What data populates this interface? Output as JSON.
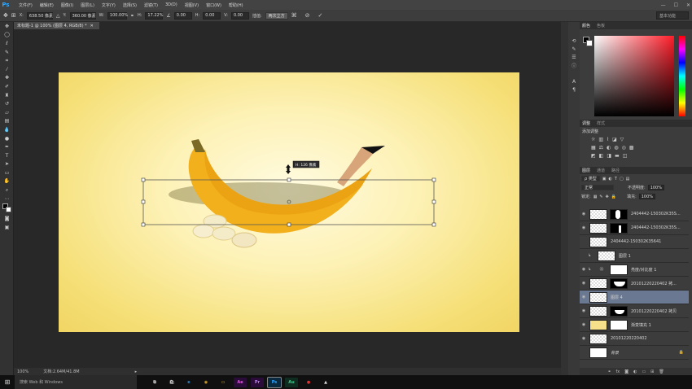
{
  "app": {
    "logo": "Ps"
  },
  "menu": [
    "文件(F)",
    "编辑(E)",
    "图像(I)",
    "图层(L)",
    "文字(Y)",
    "选择(S)",
    "滤镜(T)",
    "3D(D)",
    "视图(V)",
    "窗口(W)",
    "帮助(H)"
  ],
  "window_controls": {
    "minimize": "—",
    "maximize": "☐",
    "close": "✕"
  },
  "options": {
    "x_label": "X:",
    "x_value": "638.50 像素",
    "y_label": "Y:",
    "y_value": "360.00 像素",
    "w_label": "W:",
    "w_value": "100.00%",
    "h_label": "H:",
    "h_value": "17.22%",
    "angle_value": "0.00",
    "hskew_label": "H:",
    "hskew_value": "0.00",
    "vskew_label": "V:",
    "vskew_value": "0.00",
    "interp_label": "插值:",
    "interp_value": "两次立方",
    "workspace": "基本功能"
  },
  "document": {
    "tab_title": "未标题-1 @ 100% (图层 4, RGB/8) *",
    "tooltip": "H: 126 像素",
    "zoom": "100%",
    "doc_info": "文档:2.64M/41.8M"
  },
  "panels": {
    "color_tabs": [
      "颜色",
      "色板"
    ],
    "adjust_tabs": [
      "调整",
      "样式"
    ],
    "adjust_hint": "添加调整",
    "layers_tabs": [
      "图层",
      "通道",
      "路径"
    ],
    "kind_filter": "ρ 类型",
    "blend_mode": "正常",
    "opacity_label": "不透明度:",
    "opacity_value": "100%",
    "lock_label": "锁定:",
    "fill_label": "填充:",
    "fill_value": "100%"
  },
  "layers": [
    {
      "name": "2404442-150302K35S...",
      "has_mask": true,
      "selected": false
    },
    {
      "name": "2404442-150302K35S...",
      "has_mask": true,
      "selected": false
    },
    {
      "name": "2404442-150302K35641",
      "has_mask": false,
      "selected": false
    },
    {
      "name": "图层 1",
      "has_mask": false,
      "selected": false
    },
    {
      "name": "亮度/对比度 1",
      "has_mask": true,
      "selected": false
    },
    {
      "name": "20101220220402 拷...",
      "has_mask": true,
      "selected": false
    },
    {
      "name": "图层 4",
      "has_mask": false,
      "selected": true
    },
    {
      "name": "20101220220402 拷贝",
      "has_mask": true,
      "selected": false
    },
    {
      "name": "渐变填充 1",
      "has_mask": true,
      "selected": false
    },
    {
      "name": "20101220220402",
      "has_mask": false,
      "selected": false
    },
    {
      "name": "背景",
      "has_mask": false,
      "selected": false
    }
  ],
  "taskbar": {
    "search_placeholder": "搜索 Web 和 Windows"
  }
}
